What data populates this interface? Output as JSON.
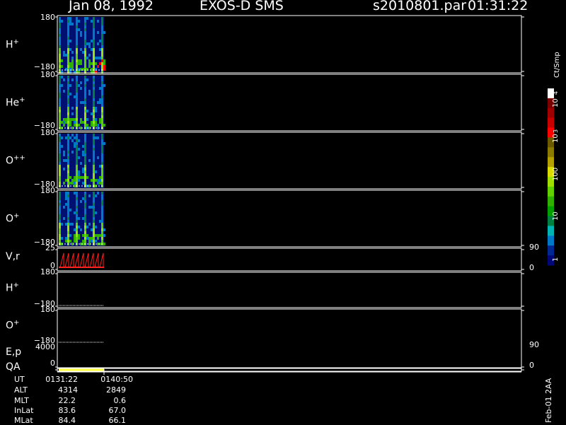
{
  "header": {
    "date": "Jan 08, 1992",
    "instrument": "EXOS-D SMS",
    "file": "s2010801.par",
    "time": "01:31:22"
  },
  "panels": [
    {
      "label": "H",
      "sup": "+",
      "ymax": "180",
      "ymin": "−180"
    },
    {
      "label": "He",
      "sup": "+",
      "ymax": "180",
      "ymin": "−180"
    },
    {
      "label": "O",
      "sup": "++",
      "ymax": "180",
      "ymin": "−180"
    },
    {
      "label": "O",
      "sup": "+",
      "ymax": "180",
      "ymin": "−180"
    },
    {
      "label": "V,r",
      "sup": "",
      "ymax": "25",
      "ymin": "0",
      "rmax": "90",
      "rmin": "0"
    },
    {
      "label": "H",
      "sup": "+",
      "ymax": "180",
      "ymin": "−180"
    },
    {
      "label": "O",
      "sup": "+",
      "ymax": "180",
      "ymin": "−180"
    },
    {
      "label": "E,p",
      "sup": "",
      "ymax": "4000",
      "ymin": "",
      "rmax": "90",
      "rmin": ""
    },
    {
      "label": "QA",
      "sup": "",
      "ymax": "",
      "ymin": "0",
      "rmax": "",
      "rmin": "0"
    }
  ],
  "colorbar": {
    "unit": "Ct/Smp",
    "ticks": [
      "10",
      "4",
      "10",
      "3",
      "100",
      "10",
      "1"
    ],
    "colors": [
      "#ffffff",
      "#7a0000",
      "#a00000",
      "#c80000",
      "#ff0000",
      "#6b5a00",
      "#8a7a00",
      "#b4a000",
      "#dcdc00",
      "#a0e000",
      "#60d000",
      "#30b000",
      "#00a000",
      "#008040",
      "#00b4b4",
      "#0078c8",
      "#002890",
      "#000878"
    ]
  },
  "footer": {
    "rows": [
      {
        "name": "UT",
        "start": "0131:22",
        "end": "0140:50"
      },
      {
        "name": "ALT",
        "start": "4314",
        "end": "2849"
      },
      {
        "name": "MLT",
        "start": "22.2",
        "end": "0.6"
      },
      {
        "name": "InLat",
        "start": "83.6",
        "end": "67.0"
      },
      {
        "name": "MLat",
        "start": "84.4",
        "end": "66.1"
      }
    ],
    "stamp": "Feb-01 2AA"
  },
  "chart_data": {
    "type": "heatmap",
    "title": "Jan 08, 1992   EXOS-D SMS",
    "xlabel": "UT",
    "x_ticks": [
      "0131:22",
      "0140:50"
    ],
    "data_extent_fraction_of_time_axis": 0.1,
    "series": [
      {
        "name": "H+",
        "ylim": [
          -180,
          180
        ],
        "dominant_levels": "1-10 with green/yellow bands, red spot near end"
      },
      {
        "name": "He+",
        "ylim": [
          -180,
          180
        ],
        "dominant_levels": "1-10 with green bands near -180"
      },
      {
        "name": "O++",
        "ylim": [
          -180,
          180
        ],
        "dominant_levels": "1-10"
      },
      {
        "name": "O+",
        "ylim": [
          -180,
          180
        ],
        "dominant_levels": "1-10"
      },
      {
        "name": "V,r",
        "type": "line",
        "ylim": [
          0,
          25
        ],
        "ylim_right": [
          0,
          90
        ]
      },
      {
        "name": "H+ (line)",
        "type": "line",
        "ylim": [
          -180,
          180
        ]
      },
      {
        "name": "O+ (line)",
        "type": "line",
        "ylim": [
          -180,
          180
        ]
      },
      {
        "name": "E,p",
        "type": "line",
        "ylim": [
          0,
          4000
        ],
        "ylim_right": [
          0,
          90
        ]
      },
      {
        "name": "QA",
        "type": "bar",
        "ylim": [
          0,
          1
        ],
        "ylim_right": [
          0,
          1
        ]
      }
    ],
    "colorbar_scale": "log",
    "colorbar_range": [
      1,
      10000
    ],
    "colorbar_unit": "Ct/Smp"
  }
}
